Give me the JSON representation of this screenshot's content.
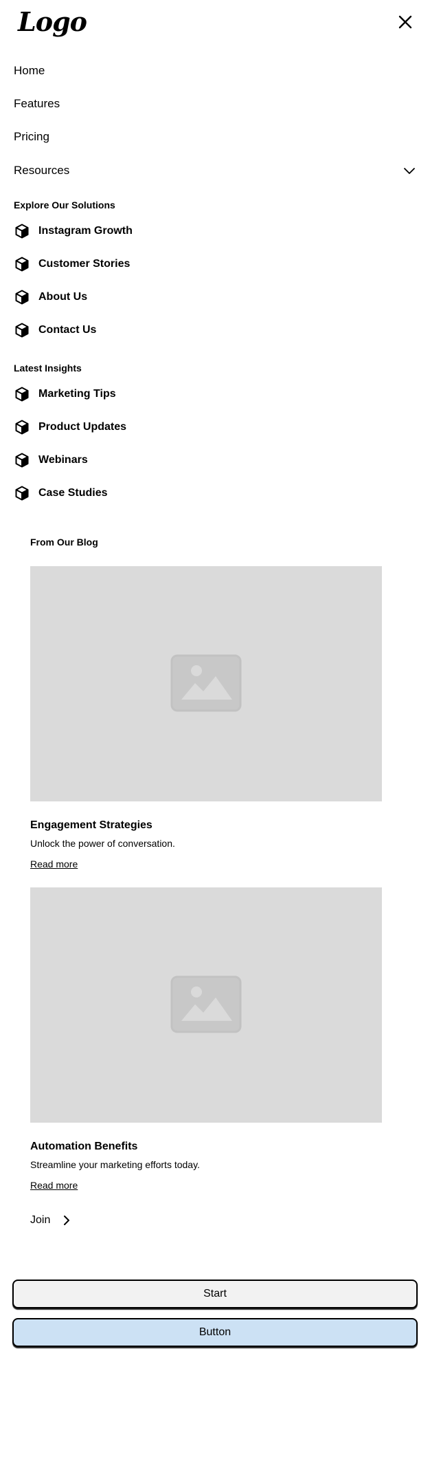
{
  "header": {
    "logo_text": "Logo",
    "close_icon": "close-icon"
  },
  "nav": {
    "home": "Home",
    "features": "Features",
    "pricing": "Pricing",
    "resources": "Resources"
  },
  "explore": {
    "title": "Explore Our Solutions",
    "items": [
      {
        "label": "Instagram Growth",
        "icon": "cube-icon"
      },
      {
        "label": "Customer Stories",
        "icon": "cube-icon"
      },
      {
        "label": "About Us",
        "icon": "cube-icon"
      },
      {
        "label": "Contact Us",
        "icon": "cube-icon"
      }
    ]
  },
  "insights": {
    "title": "Latest Insights",
    "items": [
      {
        "label": "Marketing Tips",
        "icon": "cube-icon"
      },
      {
        "label": "Product Updates",
        "icon": "cube-icon"
      },
      {
        "label": "Webinars",
        "icon": "cube-icon"
      },
      {
        "label": "Case Studies",
        "icon": "cube-icon"
      }
    ]
  },
  "blog": {
    "title": "From Our Blog",
    "posts": [
      {
        "heading": "Engagement Strategies",
        "description": "Unlock the power of conversation.",
        "link": "Read more",
        "image_icon": "image-placeholder-icon"
      },
      {
        "heading": "Automation Benefits",
        "description": "Streamline your marketing efforts today.",
        "link": "Read more",
        "image_icon": "image-placeholder-icon"
      }
    ],
    "join_label": "Join"
  },
  "buttons": {
    "start": "Start",
    "secondary": "Button"
  },
  "colors": {
    "image_bg": "#dadada",
    "start_bg": "#f2f2f2",
    "secondary_bg": "#cce1f4"
  }
}
